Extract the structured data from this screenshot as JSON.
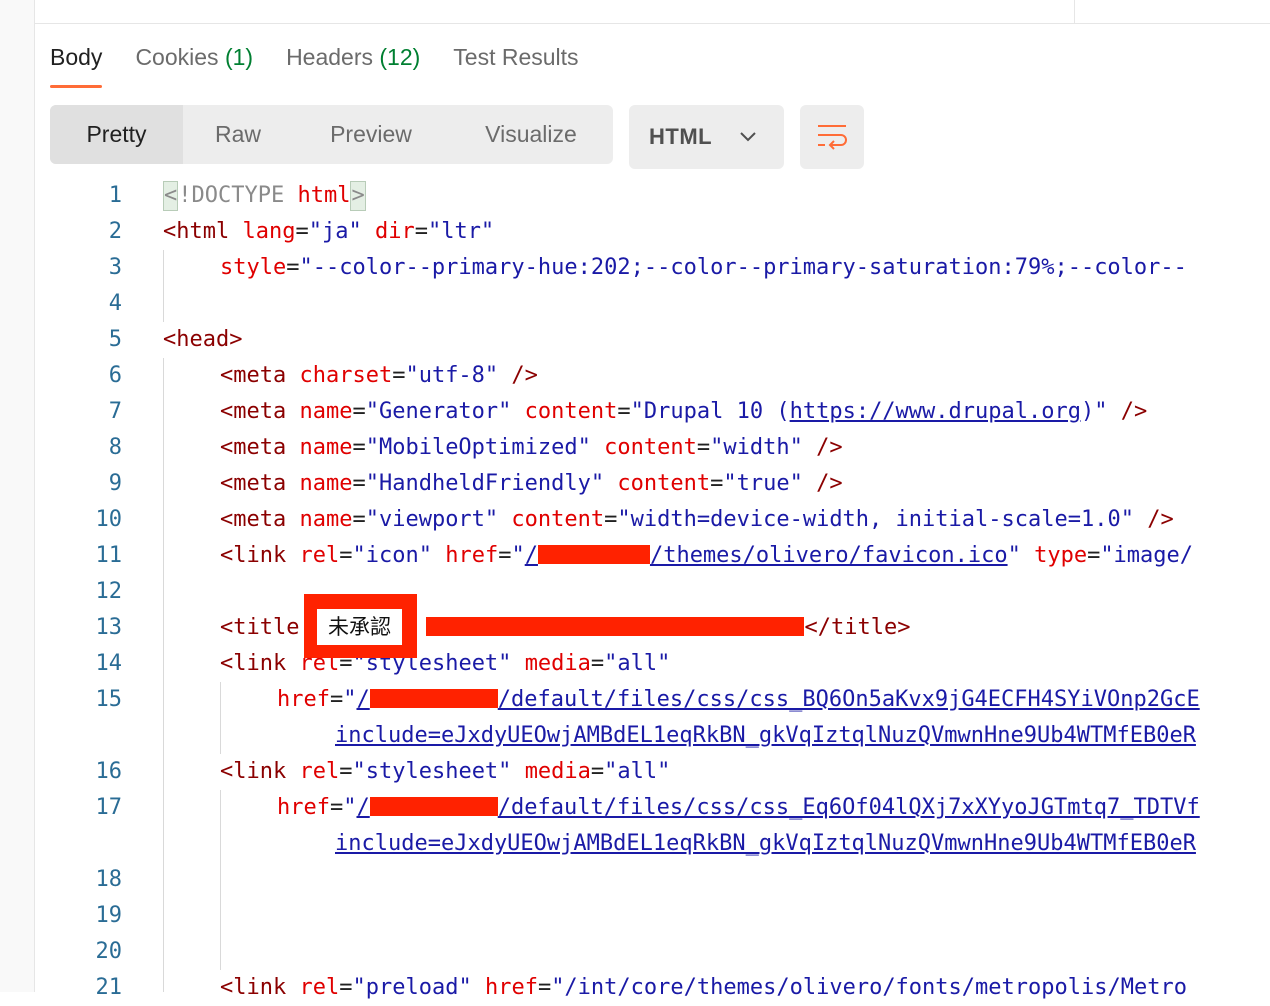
{
  "tabs": [
    {
      "label": "Body",
      "count": ""
    },
    {
      "label": "Cookies",
      "count": "(1)"
    },
    {
      "label": "Headers",
      "count": "(12)"
    },
    {
      "label": "Test Results",
      "count": ""
    }
  ],
  "modes": [
    "Pretty",
    "Raw",
    "Preview",
    "Visualize"
  ],
  "language": "HTML",
  "icons": {
    "chevron": "chevron-down-icon",
    "wrap": "wrap-lines-icon"
  },
  "colors": {
    "accent": "#ff6c37",
    "count": "#007f31",
    "redact": "#ff2200"
  },
  "line_numbers": [
    "1",
    "2",
    "3",
    "4",
    "5",
    "6",
    "7",
    "8",
    "9",
    "10",
    "11",
    "12",
    "13",
    "14",
    "15",
    "16",
    "17",
    "18",
    "19",
    "20",
    "21"
  ],
  "code": {
    "l1_doctype": "!DOCTYPE ",
    "l1_html": "html",
    "l2_tag": "<html",
    "l2_attr1": "lang",
    "l2_val1": "\"ja\"",
    "l2_attr2": "dir",
    "l2_val2": "\"ltr\"",
    "l3_attr": "style",
    "l3_val": "\"--color--primary-hue:202;--color--primary-saturation:79%;--color--",
    "l5_tag": "<head>",
    "l6_tag": "<meta",
    "l6_attr": "charset",
    "l6_val": "\"utf-8\"",
    "l7_tag": "<meta",
    "l7_attr1": "name",
    "l7_val1": "\"Generator\"",
    "l7_attr2": "content",
    "l7_val2a": "\"Drupal 10 (",
    "l7_url": "https://www.drupal.org",
    "l7_val2b": ")\"",
    "l8_tag": "<meta",
    "l8_attr1": "name",
    "l8_val1": "\"MobileOptimized\"",
    "l8_attr2": "content",
    "l8_val2": "\"width\"",
    "l9_tag": "<meta",
    "l9_attr1": "name",
    "l9_val1": "\"HandheldFriendly\"",
    "l9_attr2": "content",
    "l9_val2": "\"true\"",
    "l10_tag": "<meta",
    "l10_attr1": "name",
    "l10_val1": "\"viewport\"",
    "l10_attr2": "content",
    "l10_val2": "\"width=device-width, initial-scale=1.0\"",
    "l11_tag": "<link",
    "l11_attr1": "rel",
    "l11_val1": "\"icon\"",
    "l11_attr2": "href",
    "l11_url": "/themes/olivero/favicon.ico",
    "l11_attr3": "type",
    "l11_val3": "\"image/",
    "l13_open": "<title",
    "l13_close": "</title>",
    "l14_tag": "<link",
    "l14_attr1": "rel",
    "l14_val1": "\"stylesheet\"",
    "l14_attr2": "media",
    "l14_val2": "\"all\"",
    "l15_attr": "href",
    "l15_url": "/default/files/css/css_BQ6On5aKvx9jG4ECFH4SYiVOnp2GcE",
    "l15b_url": "include=eJxdyUEOwjAMBdEL1eqRkBN_gkVqIztqlNuzQVmwnHne9Ub4WTMfEB0eR",
    "l16_tag": "<link",
    "l16_attr1": "rel",
    "l16_val1": "\"stylesheet\"",
    "l16_attr2": "media",
    "l16_val2": "\"all\"",
    "l17_attr": "href",
    "l17_url": "/default/files/css/css_Eq6Of04lQXj7xXYyoJGTmtq7_TDTVf",
    "l17b_url": "include=eJxdyUEOwjAMBdEL1eqRkBN_gkVqIztqlNuzQVmwnHne9Ub4WTMfEB0eR",
    "l21_tag": "<link",
    "l21_attr1": "rel",
    "l21_val1": "\"preload\"",
    "l21_attr2": "href",
    "l21_val2": "\"/int/core/themes/olivero/fonts/metropolis/Metro"
  },
  "annotation_label": "未承認"
}
